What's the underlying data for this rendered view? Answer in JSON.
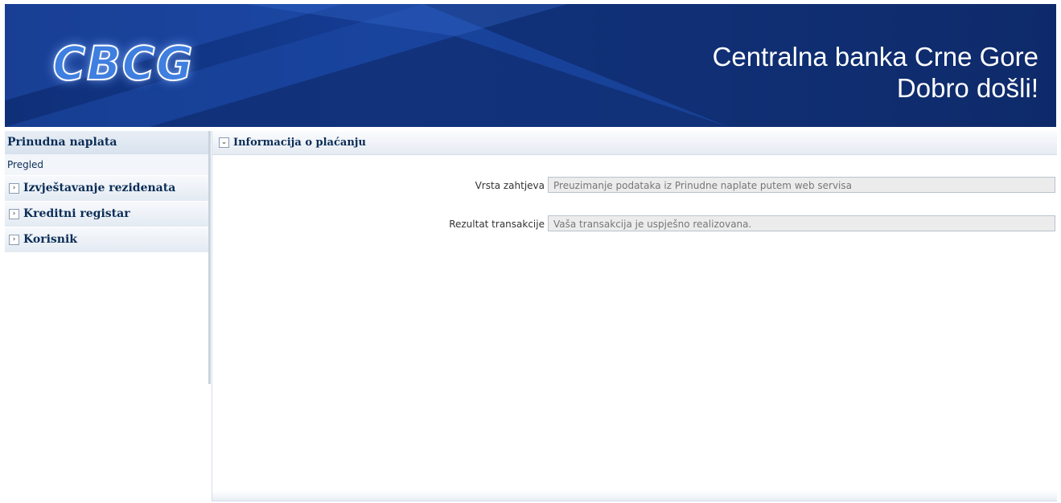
{
  "header": {
    "logo_text": "CBCG",
    "title_line1": "Centralna banka Crne Gore",
    "title_line2": "Dobro došli!"
  },
  "sidebar": {
    "section_title": "Prinudna naplata",
    "sub_item": "Pregled",
    "items": [
      {
        "label": "Izvještavanje rezidenata",
        "icon": "chevron-right-icon"
      },
      {
        "label": "Kreditni registar",
        "icon": "chevron-right-icon"
      },
      {
        "label": "Korisnik",
        "icon": "chevron-right-icon"
      }
    ]
  },
  "main": {
    "panel_title": "Informacija o plaćanju",
    "panel_icon": "chevron-down-icon",
    "fields": [
      {
        "label": "Vrsta zahtjeva",
        "value": "Preuzimanje podataka iz Prinudne naplate putem web servisa"
      },
      {
        "label": "Rezultat transakcije",
        "value": "Vaša transakcija je uspješno realizovana."
      }
    ]
  },
  "colors": {
    "banner_dark": "#0f2f78",
    "banner_accent": "#2a5cc4",
    "nav_text": "#0b2d57",
    "field_bg": "#ececec"
  }
}
